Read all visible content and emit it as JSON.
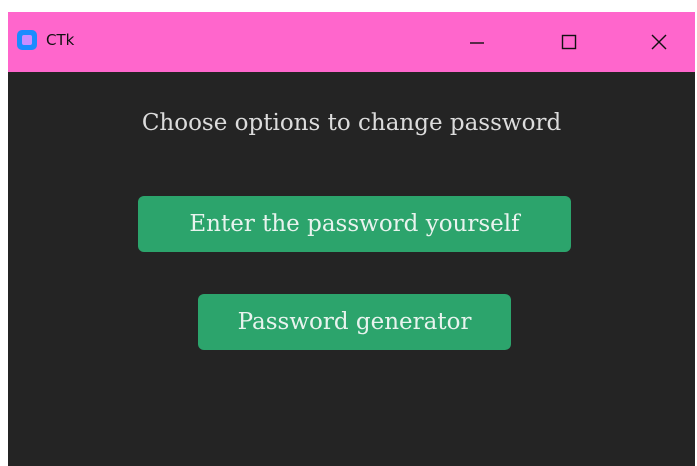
{
  "window": {
    "title": "CTk",
    "titlebar_color": "#ff66cc",
    "background_color": "#242424",
    "controls": {
      "minimize_icon": "minimize-icon",
      "maximize_icon": "maximize-icon",
      "close_icon": "close-icon"
    }
  },
  "main": {
    "heading": "Choose options to change password",
    "buttons": {
      "manual_label": "Enter the password yourself",
      "generator_label": "Password generator"
    },
    "button_color": "#2ca46c"
  }
}
